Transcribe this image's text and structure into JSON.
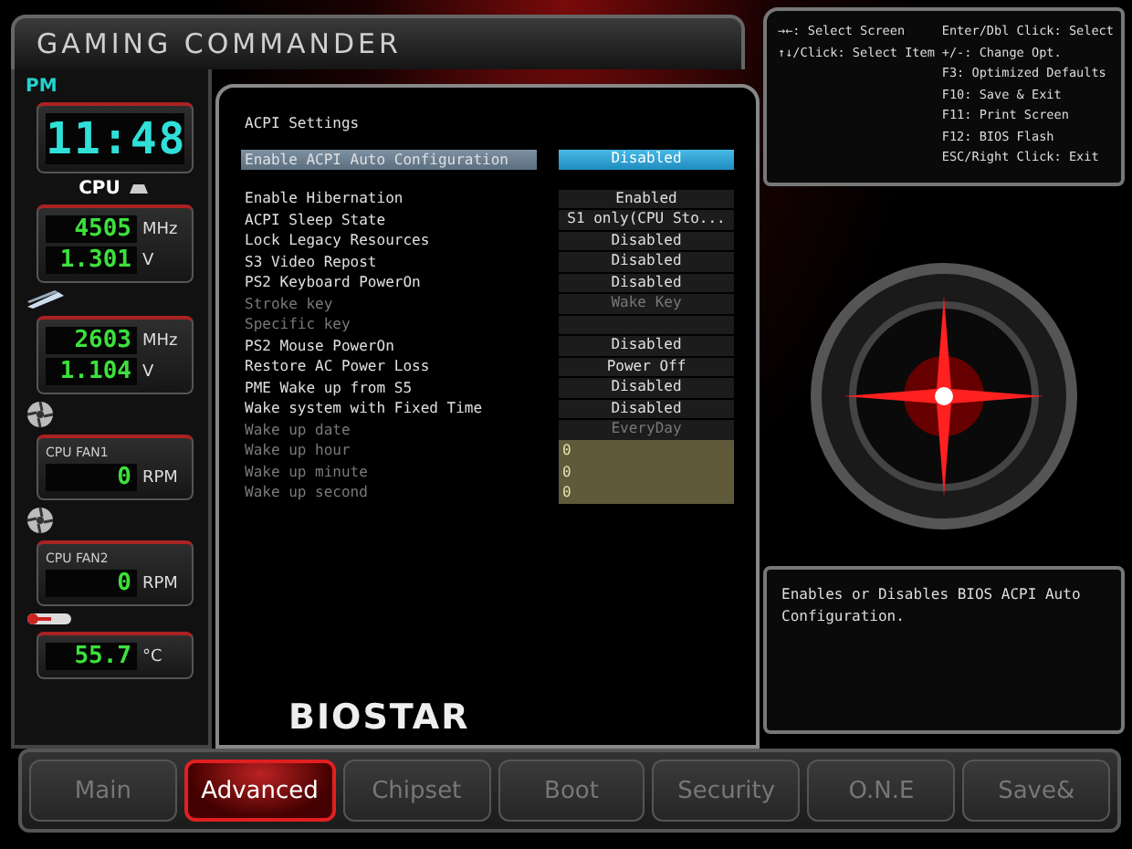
{
  "brand": {
    "title": "GAMING COMMANDER",
    "logo": "BIOSTAR"
  },
  "clock": {
    "period": "PM",
    "time": "11:48"
  },
  "monitors": [
    {
      "kind": "cpu",
      "label": "CPU",
      "readings": [
        {
          "value": "4505",
          "unit": "MHz"
        },
        {
          "value": "1.301",
          "unit": "V"
        }
      ]
    },
    {
      "kind": "memory",
      "readings": [
        {
          "value": "2603",
          "unit": "MHz"
        },
        {
          "value": "1.104",
          "unit": "V"
        }
      ]
    },
    {
      "kind": "fan",
      "label": "CPU FAN1",
      "readings": [
        {
          "value": "0",
          "unit": "RPM"
        }
      ]
    },
    {
      "kind": "fan",
      "label": "CPU FAN2",
      "readings": [
        {
          "value": "0",
          "unit": "RPM"
        }
      ]
    },
    {
      "kind": "temperature",
      "readings": [
        {
          "value": "55.7",
          "unit": "°C"
        }
      ]
    }
  ],
  "settings": [
    {
      "kind": "heading",
      "label": "ACPI Settings"
    },
    {
      "kind": "option",
      "label": "Enable ACPI Auto Configuration",
      "value": "Disabled",
      "selected": true,
      "disabled": false
    },
    {
      "kind": "gap"
    },
    {
      "kind": "option",
      "label": "Enable Hibernation",
      "value": "Enabled",
      "selected": false,
      "disabled": false
    },
    {
      "kind": "option",
      "label": "ACPI Sleep State",
      "value": "S1 only(CPU Sto...",
      "selected": false,
      "disabled": false
    },
    {
      "kind": "option",
      "label": "Lock Legacy Resources",
      "value": "Disabled",
      "selected": false,
      "disabled": false
    },
    {
      "kind": "option",
      "label": "S3 Video Repost",
      "value": "Disabled",
      "selected": false,
      "disabled": false
    },
    {
      "kind": "option",
      "label": "PS2 Keyboard PowerOn",
      "value": "Disabled",
      "selected": false,
      "disabled": false
    },
    {
      "kind": "option",
      "label": "Stroke key",
      "value": "Wake Key",
      "selected": false,
      "disabled": true
    },
    {
      "kind": "option",
      "label": "Specific key",
      "selected": false,
      "disabled": true
    },
    {
      "kind": "option",
      "label": "PS2 Mouse PowerOn",
      "value": "Disabled",
      "selected": false,
      "disabled": false
    },
    {
      "kind": "option",
      "label": "Restore AC Power Loss",
      "value": "Power Off",
      "selected": false,
      "disabled": false
    },
    {
      "kind": "option",
      "label": "PME Wake up from S5",
      "value": "Disabled",
      "selected": false,
      "disabled": false
    },
    {
      "kind": "option",
      "label": "Wake system with Fixed Time",
      "value": "Disabled",
      "selected": false,
      "disabled": false
    },
    {
      "kind": "option",
      "label": "Wake up date",
      "value": "EveryDay",
      "selected": false,
      "disabled": true
    },
    {
      "kind": "field",
      "label": "Wake up hour",
      "value": "0",
      "selected": false,
      "disabled": true
    },
    {
      "kind": "field",
      "label": "Wake up minute",
      "value": "0",
      "selected": false,
      "disabled": true
    },
    {
      "kind": "field",
      "label": "Wake up second",
      "value": "0",
      "selected": false,
      "disabled": true
    }
  ],
  "keys_left": [
    "→←: Select Screen",
    "↑↓/Click: Select Item"
  ],
  "keys_right": [
    "Enter/Dbl Click: Select",
    "+/-: Change Opt.",
    "F3: Optimized Defaults",
    "F10: Save & Exit",
    "F11: Print Screen",
    "F12: BIOS Flash",
    "ESC/Right Click: Exit"
  ],
  "help": "Enables or Disables BIOS ACPI Auto Configuration.",
  "tabs": [
    {
      "label": "Main",
      "selected": false
    },
    {
      "label": "Advanced",
      "selected": true
    },
    {
      "label": "Chipset",
      "selected": false
    },
    {
      "label": "Boot",
      "selected": false
    },
    {
      "label": "Security",
      "selected": false
    },
    {
      "label": "O.N.E",
      "selected": false
    },
    {
      "label": "Save&",
      "selected": false
    }
  ]
}
